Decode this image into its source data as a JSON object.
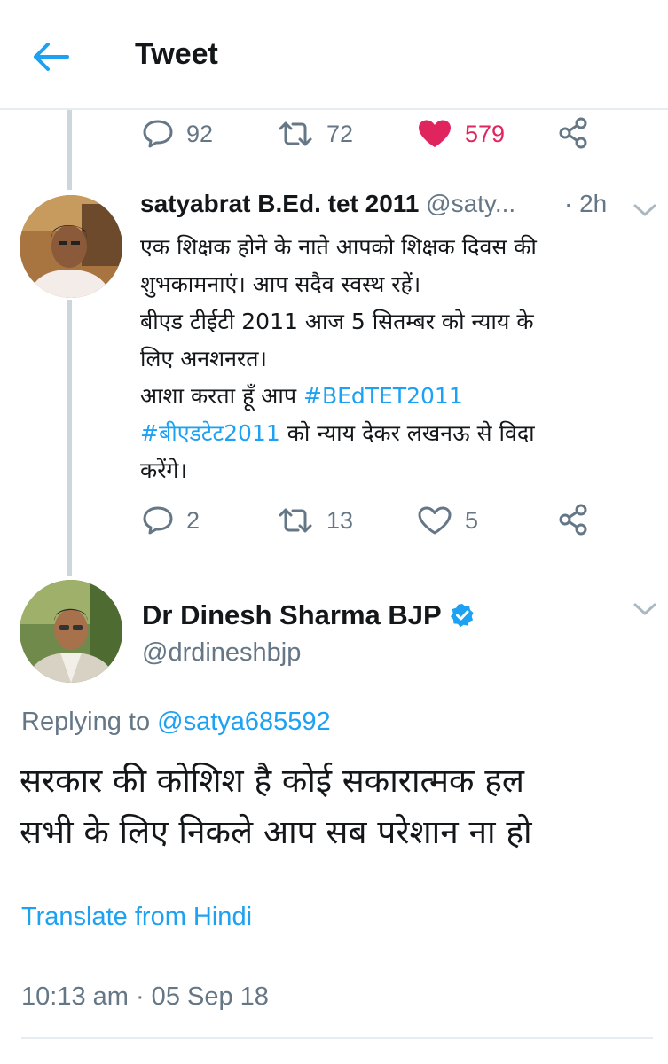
{
  "header": {
    "title": "Tweet"
  },
  "colors": {
    "accent": "#1da1f2",
    "like": "#e0245e",
    "muted": "#657786"
  },
  "parent_actions": {
    "replies": "92",
    "retweets": "72",
    "likes": "579",
    "liked": true
  },
  "reply_tweet": {
    "name": "satyabrat B.Ed. tet 2011",
    "handle": "@saty...",
    "time": "· 2h",
    "lines": [
      "एक शिक्षक होने के नाते आपको शिक्षक दिवस की",
      "शुभकामनाएं। आप सदैव स्वस्थ रहें।",
      "बीएड टीईटी 2011 आज 5 सितम्बर को न्याय के",
      "लिए अनशनरत।"
    ],
    "line5_text": "आशा करता हूँ आप ",
    "hashtag1": "#BEdTET2011",
    "hashtag2": "#बीएडटेट2011",
    "line6_text": " को न्याय देकर लखनऊ से विदा",
    "line7_text": "करेंगे।",
    "actions": {
      "replies": "2",
      "retweets": "13",
      "likes": "5"
    }
  },
  "main_tweet": {
    "name": "Dr Dinesh Sharma BJP",
    "handle": "@drdineshbjp",
    "replying_prefix": "Replying to ",
    "replying_to": "@satya685592",
    "lines": [
      "सरकार की कोशिश है कोई सकारात्मक हल",
      "सभी के लिए निकले आप सब परेशान ना हो"
    ],
    "translate": "Translate from Hindi",
    "timestamp": "10:13 am · 05 Sep 18"
  }
}
